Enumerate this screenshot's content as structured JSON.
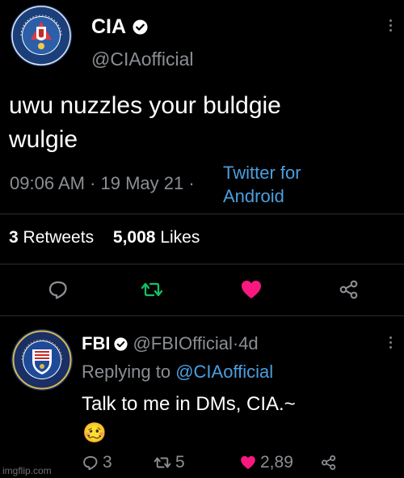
{
  "main_tweet": {
    "name": "CIA",
    "handle": "@CIAofficial",
    "text_line1": "uwu nuzzles your buldgie",
    "text_line2": "wulgie",
    "time": "09:06 AM",
    "date": "19 May 21",
    "source_line1": "Twitter for",
    "source_line2": "Android",
    "retweets_count": "3",
    "retweets_label": "Retweets",
    "likes_count": "5,008",
    "likes_label": "Likes",
    "seal_icon": "cia-seal-icon",
    "liked": true,
    "colors": {
      "like": "#f91880",
      "retweet": "#17bf63",
      "link": "#4a9fe0"
    }
  },
  "reply": {
    "name": "FBI",
    "handle": "@FBIOfficial",
    "age": "4d",
    "replying_to_label": "Replying to",
    "replying_to_handle": "@CIAofficial",
    "text": "Talk to me in DMs, CIA.~",
    "emoji": "🥴",
    "reply_count": "3",
    "retweet_count": "5",
    "like_count": "2,89",
    "seal_icon": "fbi-seal-icon"
  },
  "watermark": "imgflip.com"
}
